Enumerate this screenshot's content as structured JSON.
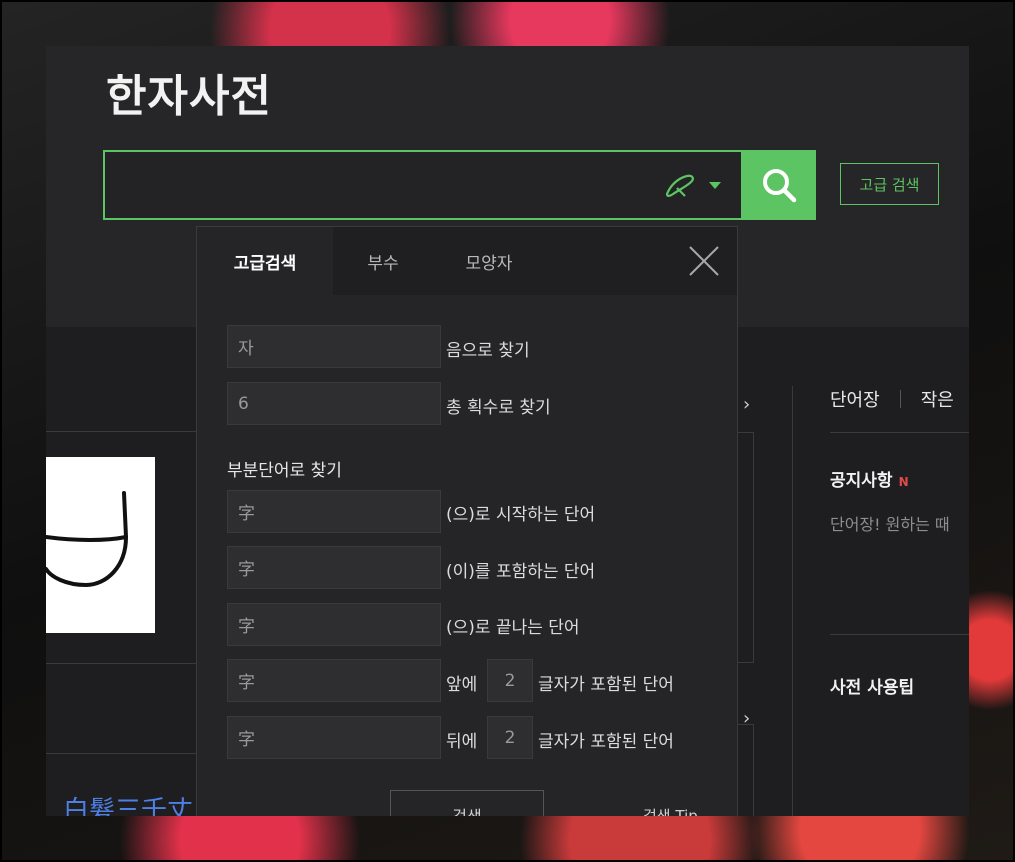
{
  "app": {
    "logo": "한자사전"
  },
  "search": {
    "value": "",
    "handwrite_icon": "brush-icon",
    "search_icon": "search-icon",
    "advanced_button": "고급 검색",
    "accent_color": "#5cc462"
  },
  "background": {
    "right_tabs": [
      "단어장",
      "작은"
    ],
    "notice_title": "공지사항",
    "notice_badge": "N",
    "notice_text": "단어장! 원하는 때",
    "tips_title": "사전 사용팁",
    "hanja_link": "白髮三千丈"
  },
  "popup": {
    "tabs": [
      {
        "label": "고급검색",
        "active": true
      },
      {
        "label": "부수",
        "active": false
      },
      {
        "label": "모양자",
        "active": false
      }
    ],
    "close_icon": "close-icon",
    "reading": {
      "value": "자",
      "label": "음으로 찾기"
    },
    "strokes": {
      "value": "6",
      "label": "총 획수로 찾기"
    },
    "partial_title": "부분단어로 찾기",
    "starts_with": {
      "value": "字",
      "label": "(으)로 시작하는 단어"
    },
    "contains": {
      "value": "字",
      "label": "(이)를 포함하는 단어"
    },
    "ends_with": {
      "value": "字",
      "label": "(으)로 끝나는 단어"
    },
    "front": {
      "value": "字",
      "prefix": "앞에",
      "count": "2",
      "suffix": "글자가 포함된 단어"
    },
    "back": {
      "value": "字",
      "prefix": "뒤에",
      "count": "2",
      "suffix": "글자가 포함된 단어"
    },
    "submit": "검색",
    "tip": "검색 Tip"
  }
}
